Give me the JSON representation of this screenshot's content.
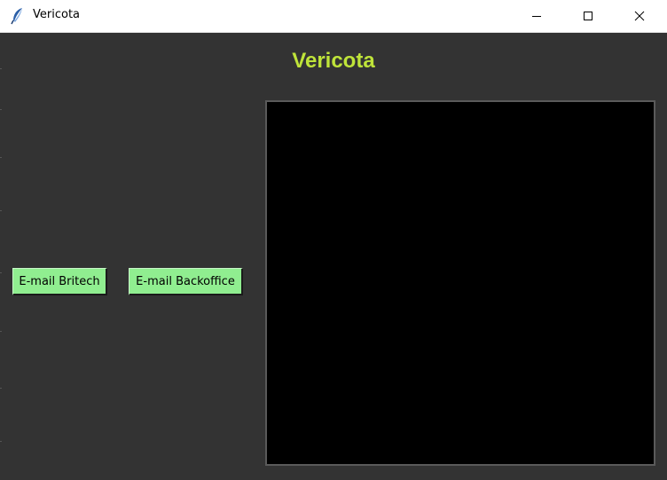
{
  "window": {
    "title": "Vericota",
    "icon": "feather-icon",
    "controls": [
      "minimize-icon",
      "maximize-icon",
      "close-icon"
    ]
  },
  "app": {
    "heading": "Vericota",
    "heading_color": "#bfe43a",
    "background_color": "#333333"
  },
  "buttons": {
    "email_britech": "E-mail Britech",
    "email_backoffice": "E-mail Backoffice",
    "button_color": "#90ee90"
  },
  "panel": {
    "background_color": "#000000"
  }
}
